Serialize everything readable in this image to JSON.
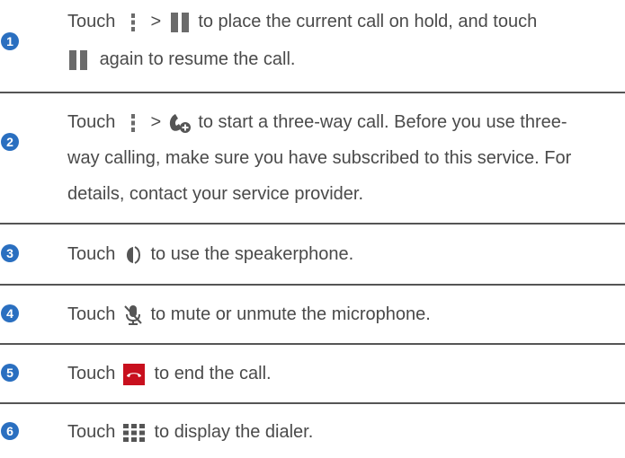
{
  "steps": [
    {
      "number": "1",
      "lines": [
        [
          "Touch ",
          "{menu}",
          " > ",
          "{pause}",
          " to place the current call on hold, and touch"
        ],
        [
          "{pause}",
          " again to resume the call."
        ]
      ],
      "t_touch": "Touch",
      "t_gt": ">",
      "t_a": "to place the current call on hold, and touch",
      "t_b": "again to resume the call."
    },
    {
      "number": "2",
      "t_touch": "Touch",
      "t_gt": ">",
      "t_a": "to start a three-way call. Before you use three-",
      "t_b": "way calling, make sure you have subscribed to this service. For",
      "t_c": "details, contact your service provider."
    },
    {
      "number": "3",
      "t_touch": "Touch",
      "t_a": "to use the speakerphone."
    },
    {
      "number": "4",
      "t_touch": "Touch",
      "t_a": "to mute or unmute the microphone."
    },
    {
      "number": "5",
      "t_touch": "Touch",
      "t_a": "to end the call."
    },
    {
      "number": "6",
      "t_touch": "Touch",
      "t_a": "to display the dialer."
    }
  ],
  "icons": {
    "menu": "menu-icon",
    "pause": "hold-icon",
    "add_call": "add-call-icon",
    "speaker": "speaker-icon",
    "mute": "mute-icon",
    "end_call": "end-call-icon",
    "dialpad": "dialpad-icon"
  },
  "colors": {
    "number_badge": "#2a6fc0",
    "end_call_red": "#c8101e",
    "icon_gray": "#6b6b6b",
    "divider": "#555555"
  }
}
